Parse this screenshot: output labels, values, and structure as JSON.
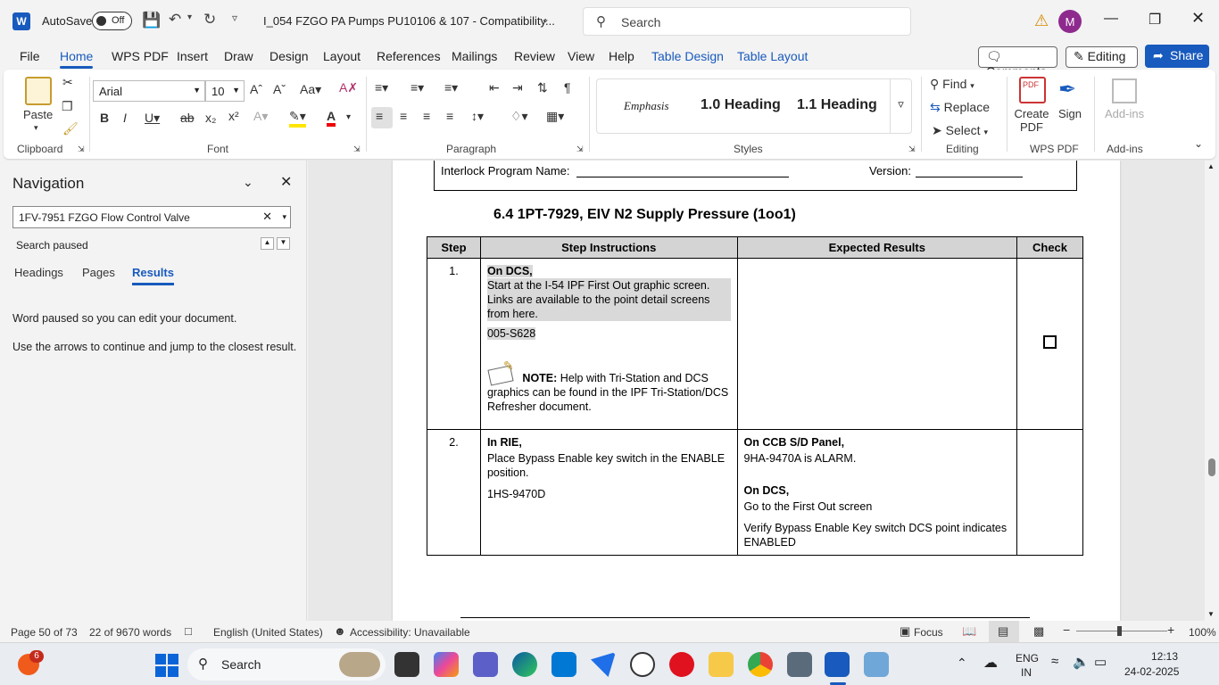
{
  "titlebar": {
    "app_letter": "W",
    "autosave_label": "AutoSave",
    "autosave_state": "Off",
    "doc_title": "I_054 FZGO PA Pumps PU10106 & 107  -  Compatibility...",
    "search_placeholder": "Search",
    "avatar_initial": "M"
  },
  "menu": {
    "items": [
      "File",
      "Home",
      "WPS PDF",
      "Insert",
      "Draw",
      "Design",
      "Layout",
      "References",
      "Mailings",
      "Review",
      "View",
      "Help",
      "Table Design",
      "Table Layout"
    ],
    "comments": "Comments",
    "editing": "Editing",
    "share": "Share"
  },
  "ribbon": {
    "clipboard": {
      "paste": "Paste",
      "label": "Clipboard"
    },
    "font": {
      "name": "Arial",
      "size": "10",
      "label": "Font"
    },
    "paragraph": {
      "label": "Paragraph"
    },
    "styles": {
      "emphasis": "Emphasis",
      "h1": "1.0  Heading",
      "h11": "1.1  Heading",
      "label": "Styles"
    },
    "editing": {
      "find": "Find",
      "replace": "Replace",
      "select": "Select",
      "label": "Editing"
    },
    "wps": {
      "create": "Create PDF",
      "sign": "Sign",
      "label": "WPS PDF"
    },
    "addins": {
      "btn": "Add-ins",
      "label": "Add-ins"
    }
  },
  "nav": {
    "title": "Navigation",
    "search_value": "1FV-7951 FZGO Flow Control Valve",
    "status": "Search paused",
    "tabs": [
      "Headings",
      "Pages",
      "Results"
    ],
    "msg1": "Word paused so you can edit your document.",
    "msg2": "Use the arrows to continue and jump to the closest result."
  },
  "document": {
    "interlock_label": "Interlock Program Name:",
    "version_label": "Version:",
    "section_title": "6.4  1PT-7929, EIV N2 Supply Pressure (1oo1)",
    "headers": [
      "Step",
      "Step Instructions",
      "Expected Results",
      "Check"
    ],
    "rows": [
      {
        "step": "1.",
        "instr_title": "On DCS,",
        "instr_text": "Start at the I-54 IPF First Out graphic screen. Links are available to the point detail screens from here.",
        "instr_code": "005-S628",
        "note_label": "NOTE:",
        "note_text": "Help with Tri-Station and DCS graphics can be found in the IPF Tri-Station/DCS Refresher document."
      },
      {
        "step": "2.",
        "instr_title": "In RIE,",
        "instr_text": "Place Bypass Enable key switch in the ENABLE position.",
        "instr_code": "1HS-9470D",
        "exp1_title": "On CCB S/D Panel,",
        "exp1_text": "9HA-9470A is ALARM.",
        "exp2_title": "On DCS,",
        "exp2_text": "Go to the First Out screen",
        "exp3_text": "Verify Bypass Enable Key switch DCS point indicates ENABLED"
      }
    ]
  },
  "status": {
    "page": "Page 50 of 73",
    "words": "22 of 9670 words",
    "language": "English (United States)",
    "accessibility": "Accessibility: Unavailable",
    "focus": "Focus",
    "zoom": "100%"
  },
  "taskbar": {
    "badge": "6",
    "search": "Search",
    "lang1": "ENG",
    "lang2": "IN",
    "time": "12:13",
    "date": "24-02-2025"
  }
}
